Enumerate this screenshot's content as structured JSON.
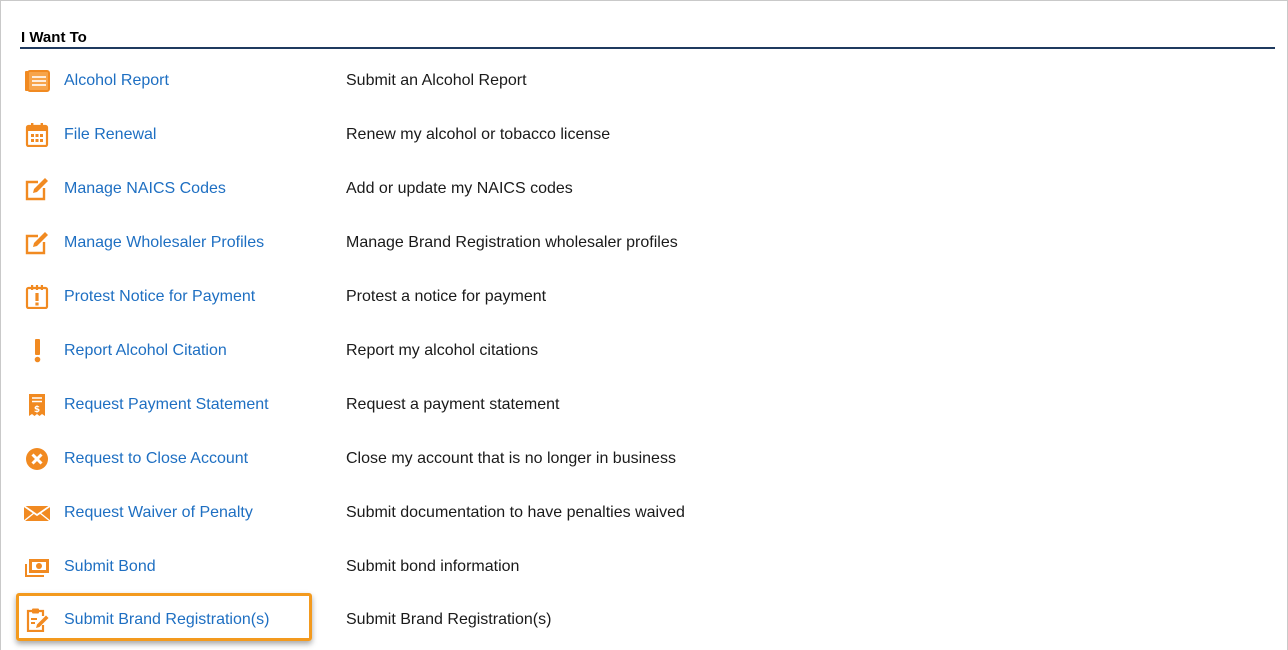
{
  "panel": {
    "title": "I Want To"
  },
  "colors": {
    "link": "#1e6fc2",
    "icon": "#f18a21",
    "header_rule": "#1f3a5f",
    "highlight": "#f39a1e"
  },
  "items": [
    {
      "icon": "document-lines-icon",
      "label": "Alcohol Report",
      "description": "Submit an Alcohol Report"
    },
    {
      "icon": "calendar-icon",
      "label": "File Renewal",
      "description": "Renew my alcohol or tobacco license"
    },
    {
      "icon": "edit-pencil-icon",
      "label": "Manage NAICS Codes",
      "description": "Add or update my NAICS codes"
    },
    {
      "icon": "edit-pencil-icon",
      "label": "Manage Wholesaler Profiles",
      "description": "Manage Brand Registration wholesaler profiles"
    },
    {
      "icon": "calendar-exclamation-icon",
      "label": "Protest Notice for Payment",
      "description": "Protest a notice for payment"
    },
    {
      "icon": "exclamation-icon",
      "label": "Report Alcohol Citation",
      "description": "Report my alcohol citations"
    },
    {
      "icon": "receipt-dollar-icon",
      "label": "Request Payment Statement",
      "description": "Request a payment statement"
    },
    {
      "icon": "close-circle-icon",
      "label": "Request to Close Account",
      "description": "Close my account that is no longer in business"
    },
    {
      "icon": "envelope-icon",
      "label": "Request Waiver of Penalty",
      "description": "Submit documentation to have penalties waived"
    },
    {
      "icon": "money-bill-icon",
      "label": "Submit Bond",
      "description": "Submit bond information"
    },
    {
      "icon": "clipboard-edit-icon",
      "label": "Submit Brand Registration(s)",
      "description": "Submit Brand Registration(s)",
      "highlighted": true
    }
  ]
}
